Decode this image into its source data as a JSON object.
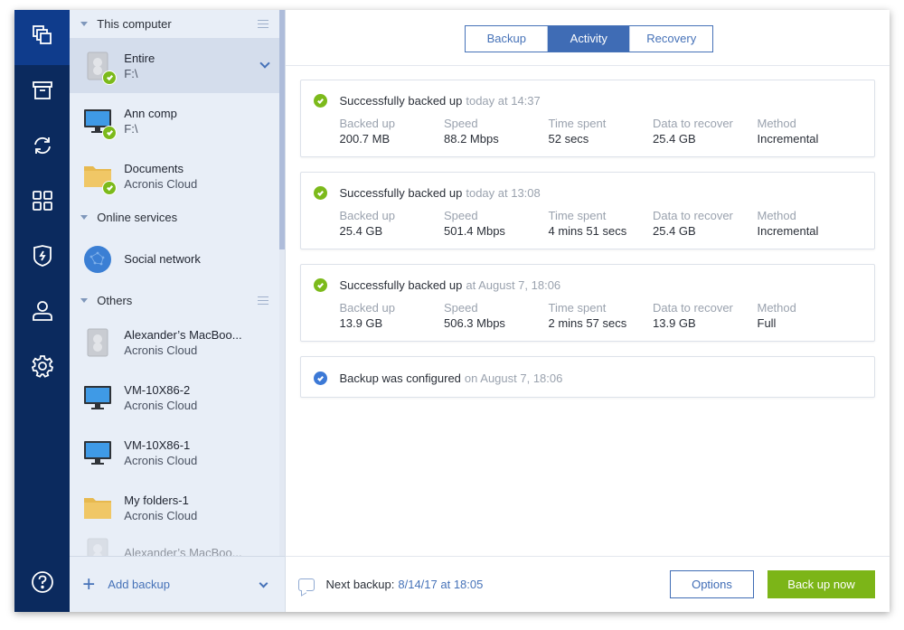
{
  "rail": {
    "items": [
      {
        "name": "backup-icon",
        "active": true
      },
      {
        "name": "archive-icon",
        "active": false
      },
      {
        "name": "sync-icon",
        "active": false
      },
      {
        "name": "tools-icon",
        "active": false
      },
      {
        "name": "protection-icon",
        "active": false
      },
      {
        "name": "account-icon",
        "active": false
      },
      {
        "name": "settings-icon",
        "active": false
      }
    ],
    "help_icon": "help-icon"
  },
  "sources": {
    "groups": [
      {
        "title": "This computer",
        "has_menu": true,
        "items": [
          {
            "name": "Entire",
            "sub": "F:\\",
            "icon": "disk",
            "ok": true,
            "selected": true
          },
          {
            "name": "Ann comp",
            "sub": "F:\\",
            "icon": "monitor",
            "ok": true
          },
          {
            "name": "Documents",
            "sub": "Acronis Cloud",
            "icon": "folder",
            "ok": true
          }
        ]
      },
      {
        "title": "Online services",
        "has_menu": false,
        "items": [
          {
            "name": "Social network",
            "sub": "",
            "icon": "globe",
            "ok": false
          }
        ]
      },
      {
        "title": "Others",
        "has_menu": true,
        "items": [
          {
            "name": "Alexander’s MacBoo...",
            "sub": "Acronis Cloud",
            "icon": "disk",
            "ok": false
          },
          {
            "name": "VM-10X86-2",
            "sub": "Acronis Cloud",
            "icon": "monitor",
            "ok": false
          },
          {
            "name": "VM-10X86-1",
            "sub": "Acronis Cloud",
            "icon": "monitor",
            "ok": false
          },
          {
            "name": "My folders-1",
            "sub": "Acronis Cloud",
            "icon": "folder",
            "ok": false
          },
          {
            "name": "Alexander’s MacBoo...",
            "sub": "",
            "icon": "disk",
            "ok": false,
            "faded": true
          }
        ]
      }
    ],
    "add_backup_label": "Add backup"
  },
  "tabs": [
    {
      "label": "Backup",
      "active": false
    },
    {
      "label": "Activity",
      "active": true
    },
    {
      "label": "Recovery",
      "active": false
    }
  ],
  "activity": [
    {
      "status": "ok",
      "title": "Successfully backed up",
      "when": "today at 14:37",
      "stats": [
        {
          "label": "Backed up",
          "value": "200.7 MB"
        },
        {
          "label": "Speed",
          "value": "88.2 Mbps"
        },
        {
          "label": "Time spent",
          "value": "52 secs"
        },
        {
          "label": "Data to recover",
          "value": "25.4 GB"
        },
        {
          "label": "Method",
          "value": "Incremental"
        }
      ]
    },
    {
      "status": "ok",
      "title": "Successfully backed up",
      "when": "today at 13:08",
      "stats": [
        {
          "label": "Backed up",
          "value": "25.4 GB"
        },
        {
          "label": "Speed",
          "value": "501.4 Mbps"
        },
        {
          "label": "Time spent",
          "value": "4 mins 51 secs"
        },
        {
          "label": "Data to recover",
          "value": "25.4 GB"
        },
        {
          "label": "Method",
          "value": "Incremental"
        }
      ]
    },
    {
      "status": "ok",
      "title": "Successfully backed up",
      "when": "at August 7, 18:06",
      "stats": [
        {
          "label": "Backed up",
          "value": "13.9 GB"
        },
        {
          "label": "Speed",
          "value": "506.3 Mbps"
        },
        {
          "label": "Time spent",
          "value": "2 mins 57 secs"
        },
        {
          "label": "Data to recover",
          "value": "13.9 GB"
        },
        {
          "label": "Method",
          "value": "Full"
        }
      ]
    },
    {
      "status": "info",
      "title": "Backup was configured",
      "when": "on August 7, 18:06",
      "stats": []
    }
  ],
  "footer": {
    "next_label": "Next backup:",
    "next_value": "8/14/17 at 18:05",
    "options_label": "Options",
    "backup_now_label": "Back up now"
  },
  "colors": {
    "rail": "#0b2a5e",
    "accent": "#3f6cb5",
    "success": "#7cba1b",
    "info": "#3c79d6",
    "primary_button": "#7cb518"
  }
}
